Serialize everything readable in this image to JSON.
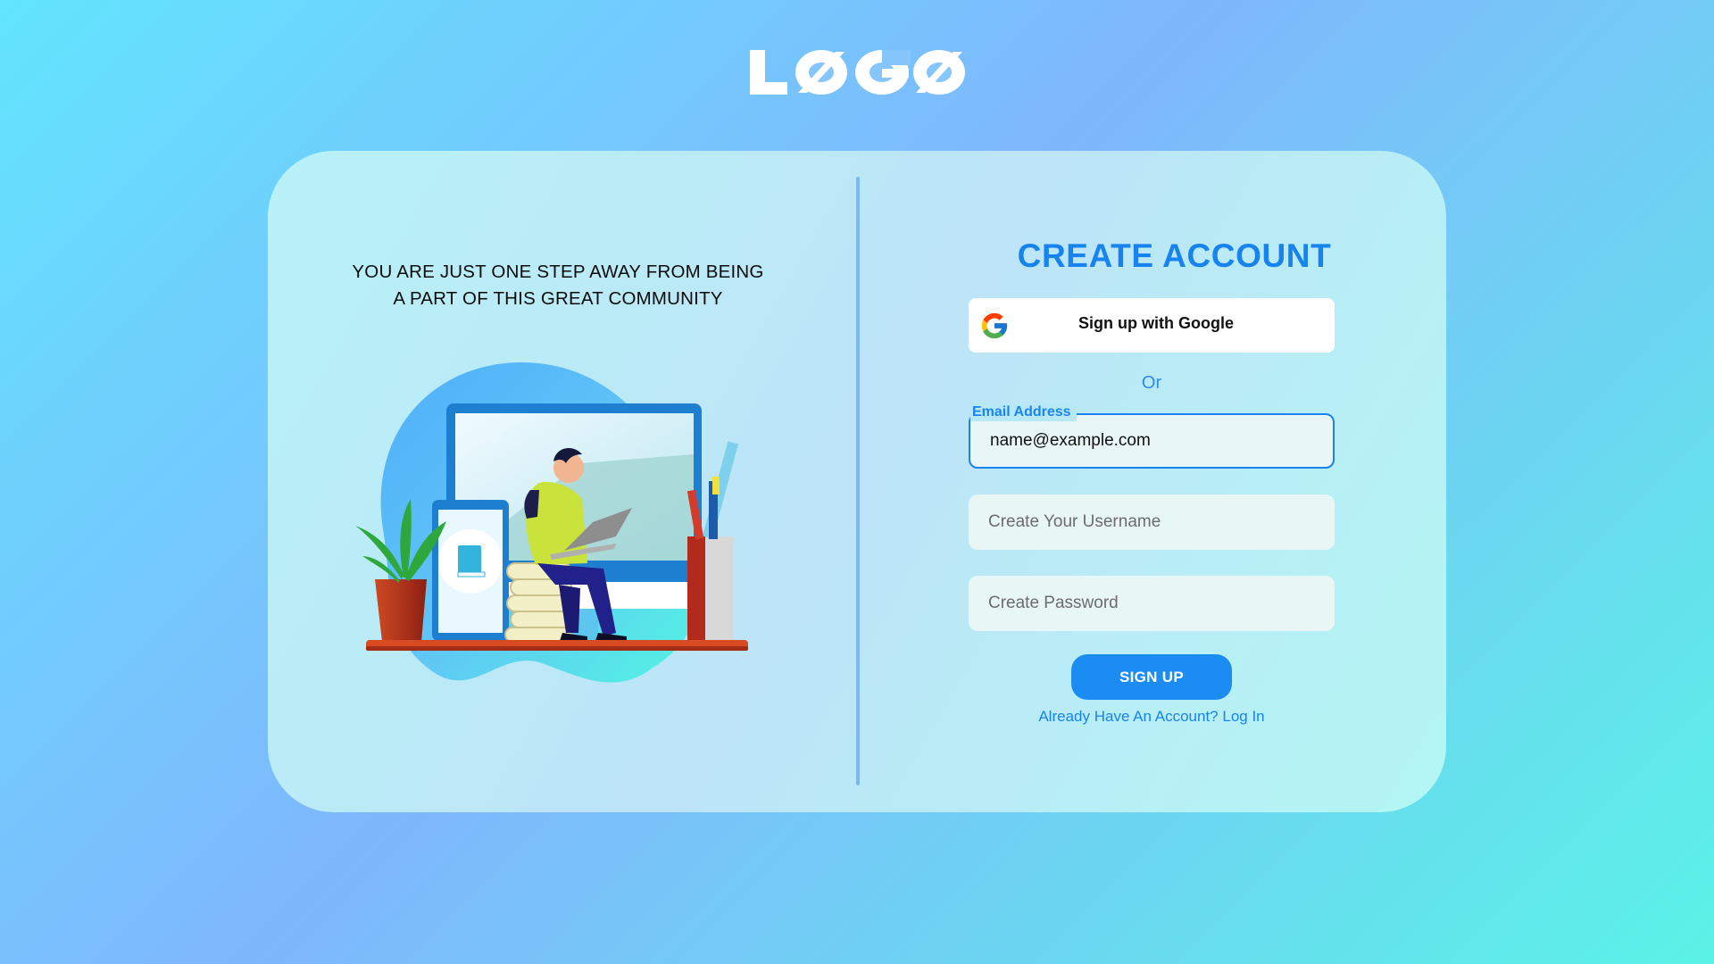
{
  "logo": {
    "text": "LØGØ",
    "color": "#ffffff"
  },
  "left_panel": {
    "tagline_line1": "YOU ARE JUST ONE STEP AWAY FROM BEING",
    "tagline_line2": "A PART OF THIS GREAT COMMUNITY"
  },
  "form": {
    "title": "CREATE ACCOUNT",
    "google_button_label": "Sign up with Google",
    "or_text": "Or",
    "email": {
      "label": "Email Address",
      "value": "name@example.com"
    },
    "username": {
      "placeholder": "Create Your Username"
    },
    "password": {
      "placeholder": "Create Password"
    },
    "signup_label": "SIGN UP",
    "login_link": "Already Have An Account? Log In"
  },
  "colors": {
    "accent": "#1683ee",
    "button": "#1a8cf2",
    "card_background": "#bde4f7",
    "page_gradient_start": "#62e4fd",
    "page_gradient_end": "#5af2e6"
  },
  "icons": {
    "google": "google-g-icon"
  }
}
